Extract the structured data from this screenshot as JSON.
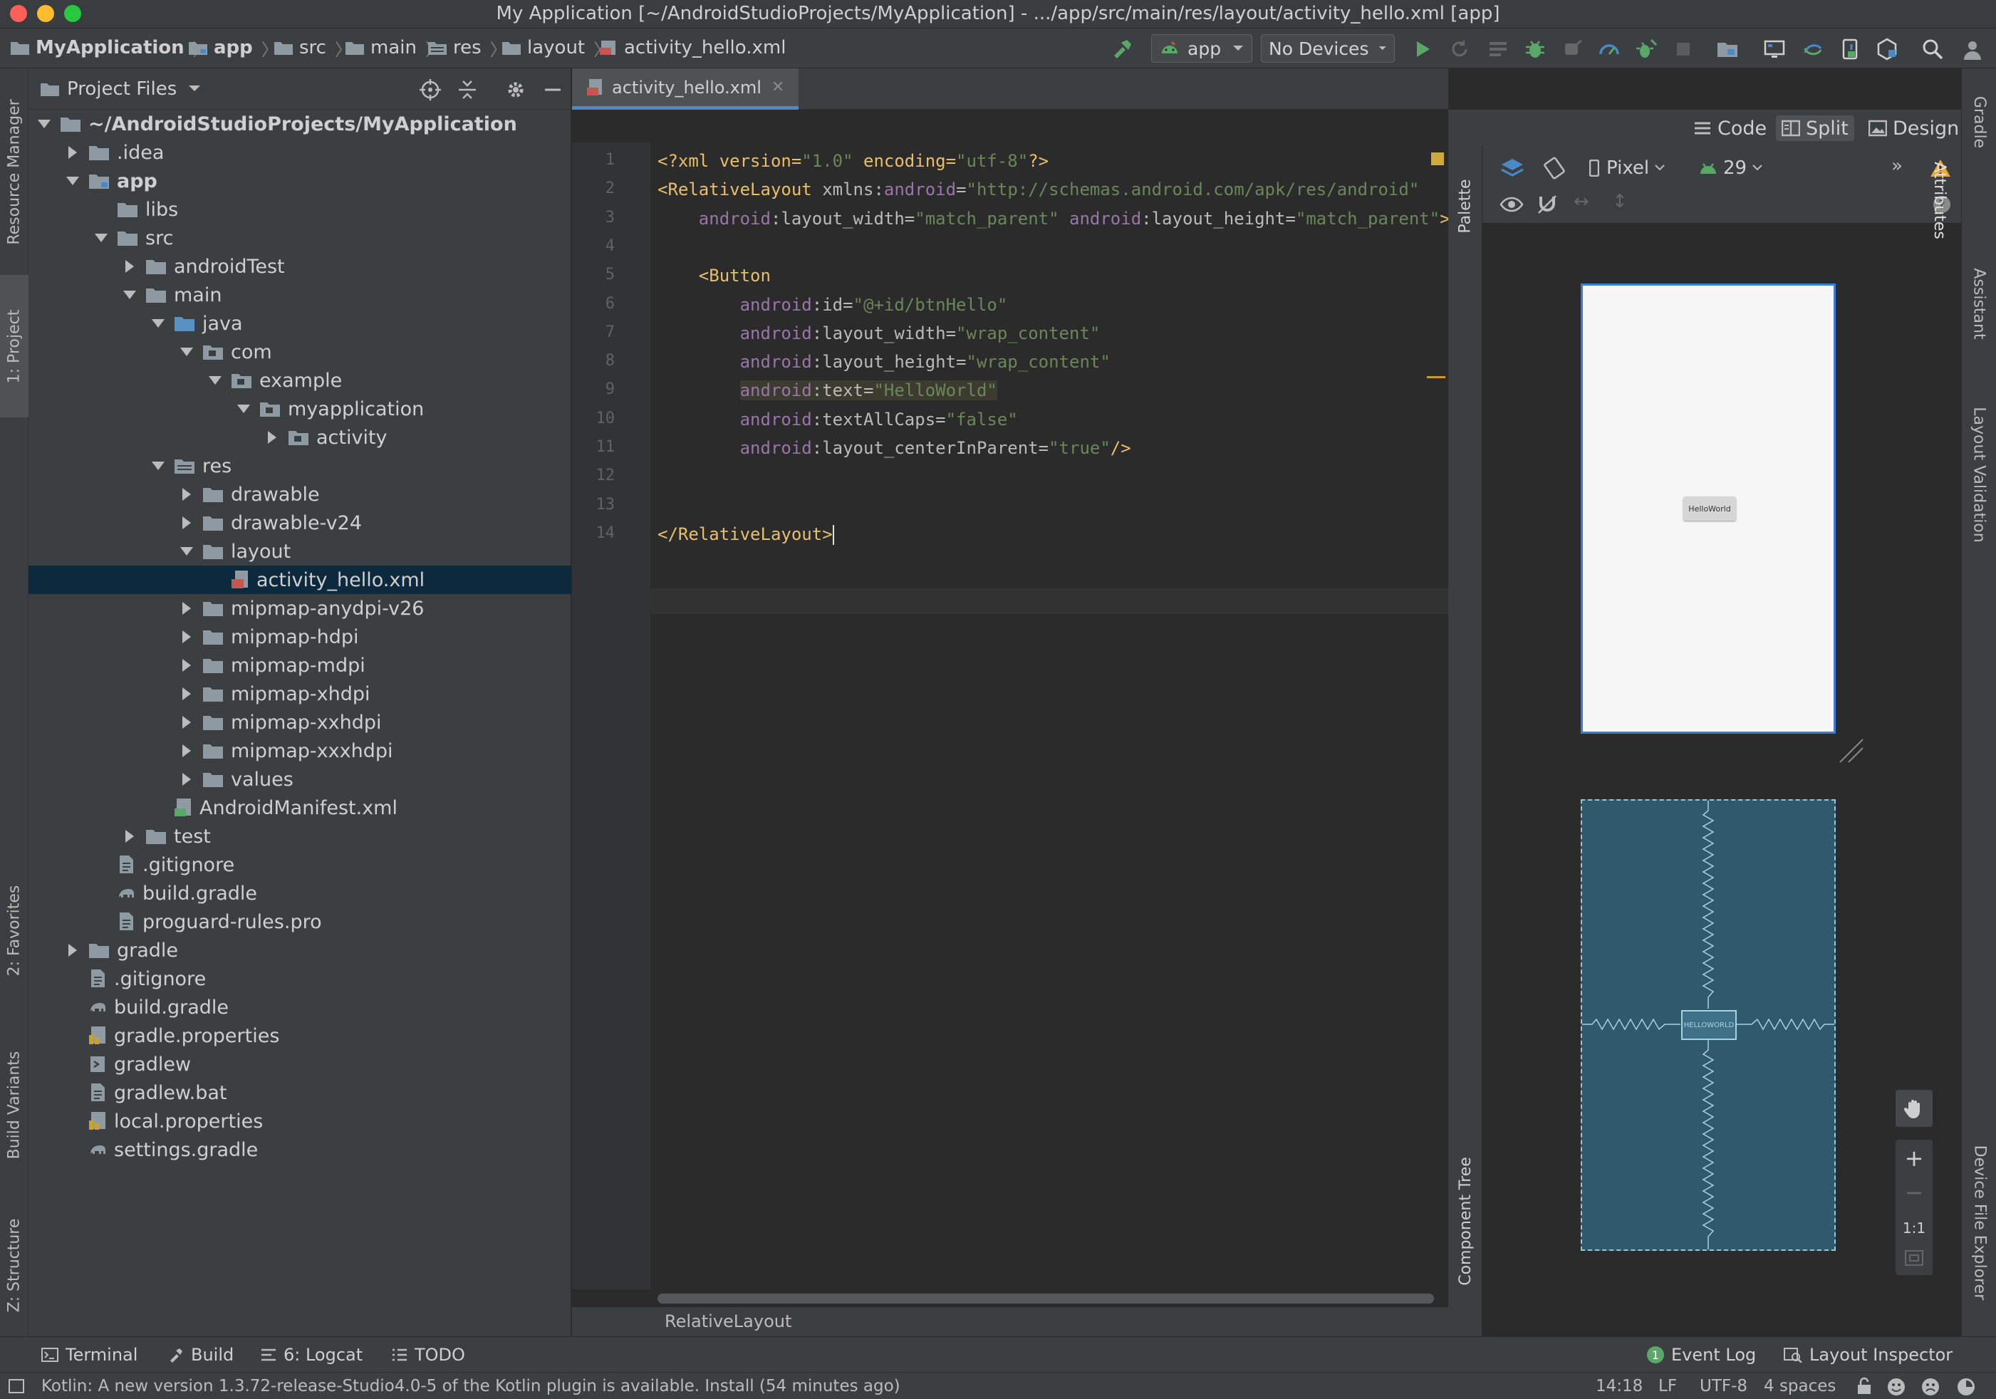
{
  "window": {
    "title": "My Application [~/AndroidStudioProjects/MyApplication] - .../app/src/main/res/layout/activity_hello.xml [app]"
  },
  "navbar": {
    "breadcrumbs": [
      "MyApplication",
      "app",
      "src",
      "main",
      "res",
      "layout",
      "activity_hello.xml"
    ],
    "run_config": "app",
    "device": "No Devices"
  },
  "left_strip": {
    "tabs": [
      "Resource Manager",
      "1: Project",
      "2: Favorites",
      "Build Variants",
      "Z: Structure"
    ]
  },
  "project_panel": {
    "view_selector": "Project Files",
    "tree": [
      {
        "label": "~/AndroidStudioProjects/MyApplication",
        "depth": 0,
        "expanded": true,
        "kind": "folder",
        "bold": true
      },
      {
        "label": ".idea",
        "depth": 1,
        "expanded": false,
        "kind": "folder"
      },
      {
        "label": "app",
        "depth": 1,
        "expanded": true,
        "kind": "module",
        "bold": true
      },
      {
        "label": "libs",
        "depth": 2,
        "kind": "folder"
      },
      {
        "label": "src",
        "depth": 2,
        "expanded": true,
        "kind": "folder"
      },
      {
        "label": "androidTest",
        "depth": 3,
        "expanded": false,
        "kind": "folder"
      },
      {
        "label": "main",
        "depth": 3,
        "expanded": true,
        "kind": "folder"
      },
      {
        "label": "java",
        "depth": 4,
        "expanded": true,
        "kind": "source-folder"
      },
      {
        "label": "com",
        "depth": 5,
        "expanded": true,
        "kind": "package"
      },
      {
        "label": "example",
        "depth": 6,
        "expanded": true,
        "kind": "package"
      },
      {
        "label": "myapplication",
        "depth": 7,
        "expanded": true,
        "kind": "package"
      },
      {
        "label": "activity",
        "depth": 8,
        "expanded": false,
        "kind": "package"
      },
      {
        "label": "res",
        "depth": 4,
        "expanded": true,
        "kind": "res-folder"
      },
      {
        "label": "drawable",
        "depth": 5,
        "expanded": false,
        "kind": "folder"
      },
      {
        "label": "drawable-v24",
        "depth": 5,
        "expanded": false,
        "kind": "folder"
      },
      {
        "label": "layout",
        "depth": 5,
        "expanded": true,
        "kind": "folder"
      },
      {
        "label": "activity_hello.xml",
        "depth": 6,
        "kind": "layout-file",
        "selected": true
      },
      {
        "label": "mipmap-anydpi-v26",
        "depth": 5,
        "expanded": false,
        "kind": "folder"
      },
      {
        "label": "mipmap-hdpi",
        "depth": 5,
        "expanded": false,
        "kind": "folder"
      },
      {
        "label": "mipmap-mdpi",
        "depth": 5,
        "expanded": false,
        "kind": "folder"
      },
      {
        "label": "mipmap-xhdpi",
        "depth": 5,
        "expanded": false,
        "kind": "folder"
      },
      {
        "label": "mipmap-xxhdpi",
        "depth": 5,
        "expanded": false,
        "kind": "folder"
      },
      {
        "label": "mipmap-xxxhdpi",
        "depth": 5,
        "expanded": false,
        "kind": "folder"
      },
      {
        "label": "values",
        "depth": 5,
        "expanded": false,
        "kind": "folder"
      },
      {
        "label": "AndroidManifest.xml",
        "depth": 4,
        "kind": "manifest-file"
      },
      {
        "label": "test",
        "depth": 3,
        "expanded": false,
        "kind": "folder"
      },
      {
        "label": ".gitignore",
        "depth": 2,
        "kind": "text-file"
      },
      {
        "label": "build.gradle",
        "depth": 2,
        "kind": "gradle-file"
      },
      {
        "label": "proguard-rules.pro",
        "depth": 2,
        "kind": "text-file"
      },
      {
        "label": "gradle",
        "depth": 1,
        "expanded": false,
        "kind": "folder"
      },
      {
        "label": ".gitignore",
        "depth": 1,
        "kind": "text-file"
      },
      {
        "label": "build.gradle",
        "depth": 1,
        "kind": "gradle-file"
      },
      {
        "label": "gradle.properties",
        "depth": 1,
        "kind": "properties-file"
      },
      {
        "label": "gradlew",
        "depth": 1,
        "kind": "script-file"
      },
      {
        "label": "gradlew.bat",
        "depth": 1,
        "kind": "text-file"
      },
      {
        "label": "local.properties",
        "depth": 1,
        "kind": "properties-file"
      },
      {
        "label": "settings.gradle",
        "depth": 1,
        "kind": "gradle-file"
      }
    ]
  },
  "editor": {
    "tab_label": "activity_hello.xml",
    "modes": {
      "code": "Code",
      "split": "Split",
      "design": "Design"
    },
    "active_mode": "Split",
    "lines": [
      [
        [
          "pi",
          "<?xml version="
        ],
        [
          "str",
          "\"1.0\""
        ],
        [
          "pi",
          " encoding="
        ],
        [
          "str",
          "\"utf-8\""
        ],
        [
          "pi",
          "?>"
        ]
      ],
      [
        [
          "tag",
          "<RelativeLayout"
        ],
        [
          "attr",
          " xmlns:"
        ],
        [
          "ns",
          "android"
        ],
        [
          "attr",
          "="
        ],
        [
          "str",
          "\"http://schemas.android.com/apk/res/android\""
        ]
      ],
      [
        [
          "attr",
          "    "
        ],
        [
          "ns",
          "android"
        ],
        [
          "attr",
          ":layout_width="
        ],
        [
          "str",
          "\"match_parent\""
        ],
        [
          "attr",
          " "
        ],
        [
          "ns",
          "android"
        ],
        [
          "attr",
          ":layout_height="
        ],
        [
          "str",
          "\"match_parent\""
        ],
        [
          "tag",
          ">"
        ]
      ],
      [],
      [
        [
          "attr",
          "    "
        ],
        [
          "tag",
          "<Button"
        ]
      ],
      [
        [
          "attr",
          "        "
        ],
        [
          "ns",
          "android"
        ],
        [
          "attr",
          ":id="
        ],
        [
          "str",
          "\"@+id/btnHello\""
        ]
      ],
      [
        [
          "attr",
          "        "
        ],
        [
          "ns",
          "android"
        ],
        [
          "attr",
          ":layout_width="
        ],
        [
          "str",
          "\"wrap_content\""
        ]
      ],
      [
        [
          "attr",
          "        "
        ],
        [
          "ns",
          "android"
        ],
        [
          "attr",
          ":layout_height="
        ],
        [
          "str",
          "\"wrap_content\""
        ]
      ],
      [
        [
          "attr",
          "        "
        ],
        [
          "ns",
          "android"
        ],
        [
          "attr",
          ":text="
        ],
        [
          "str",
          "\"HelloWorld\""
        ]
      ],
      [
        [
          "attr",
          "        "
        ],
        [
          "ns",
          "android"
        ],
        [
          "attr",
          ":textAllCaps="
        ],
        [
          "str",
          "\"false\""
        ]
      ],
      [
        [
          "attr",
          "        "
        ],
        [
          "ns",
          "android"
        ],
        [
          "attr",
          ":layout_centerInParent="
        ],
        [
          "str",
          "\"true\""
        ],
        [
          "tag",
          "/>"
        ]
      ],
      [],
      [],
      [
        [
          "tag",
          "</RelativeLayout>"
        ]
      ]
    ],
    "bottom_breadcrumb": "RelativeLayout"
  },
  "design": {
    "palette_label": "Palette",
    "component_tree_label": "Component Tree",
    "device": "Pixel",
    "api_level": "29",
    "preview_button_text": "HelloWorld",
    "blueprint_button_text": "HELLOWORLD",
    "zoom_fit_label": "1:1"
  },
  "right_strip": {
    "tabs": [
      "Gradle",
      "Attributes",
      "Assistant",
      "Layout Validation",
      "Device File Explorer"
    ]
  },
  "bottom_tools": {
    "terminal": "Terminal",
    "build": "Build",
    "logcat": "6: Logcat",
    "todo": "TODO",
    "event_log": "Event Log",
    "layout_inspector": "Layout Inspector",
    "event_count": "1"
  },
  "status": {
    "message": "Kotlin: A new version 1.3.72-release-Studio4.0-5 of the Kotlin plugin is available. Install (54 minutes ago)",
    "position": "14:18",
    "line_sep": "LF",
    "encoding": "UTF-8",
    "indent": "4 spaces"
  },
  "colors": {
    "accent": "#4a88c7",
    "selection": "#0d293e",
    "blueprint": "#2f5a6e",
    "run_green": "#59a869",
    "warning": "#f0a732"
  }
}
